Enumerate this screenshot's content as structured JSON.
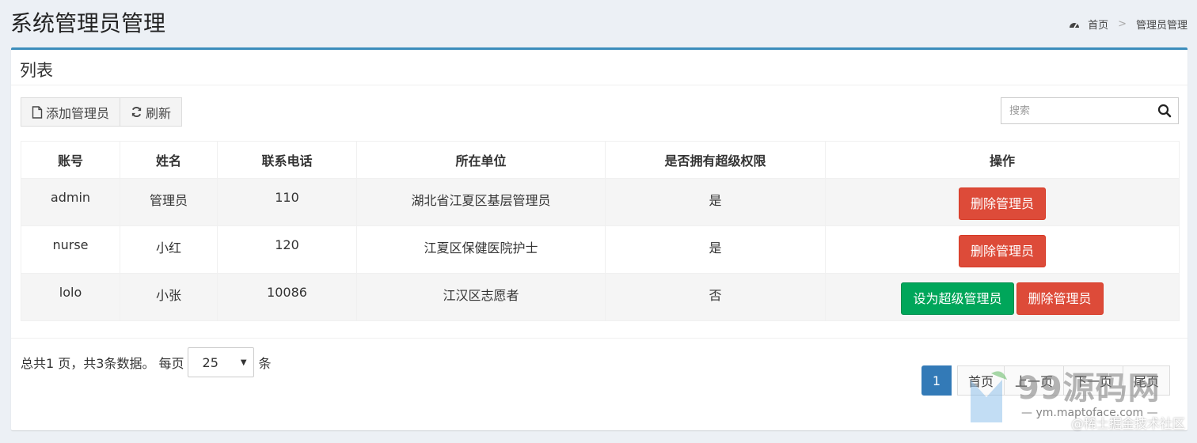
{
  "page": {
    "title": "系统管理员管理",
    "breadcrumb": {
      "home": "首页",
      "current": "管理员管理"
    }
  },
  "box": {
    "title": "列表",
    "toolbar": {
      "add_label": "添加管理员",
      "refresh_label": "刷新"
    },
    "search": {
      "placeholder": "搜索",
      "value": ""
    }
  },
  "table": {
    "headers": [
      "账号",
      "姓名",
      "联系电话",
      "所在单位",
      "是否拥有超级权限",
      "操作"
    ],
    "rows": [
      {
        "account": "admin",
        "name": "管理员",
        "phone": "110",
        "unit": "湖北省江夏区基层管理员",
        "super": "是",
        "actions": [
          "删除管理员"
        ]
      },
      {
        "account": "nurse",
        "name": "小红",
        "phone": "120",
        "unit": "江夏区保健医院护士",
        "super": "是",
        "actions": [
          "删除管理员"
        ]
      },
      {
        "account": "lolo",
        "name": "小张",
        "phone": "10086",
        "unit": "江汉区志愿者",
        "super": "否",
        "actions": [
          "设为超级管理员",
          "删除管理员"
        ]
      }
    ]
  },
  "pagination": {
    "summary_prefix": "总共1 页，共3条数据。 每页",
    "page_size": "25",
    "summary_suffix": "条",
    "pages": [
      "1",
      "首页",
      "上一页",
      "下一页",
      "尾页"
    ]
  },
  "watermark": {
    "brand": "99源码网",
    "sub": "— ym.maptoface.com —",
    "corner": "@稀土掘金技术社区"
  }
}
